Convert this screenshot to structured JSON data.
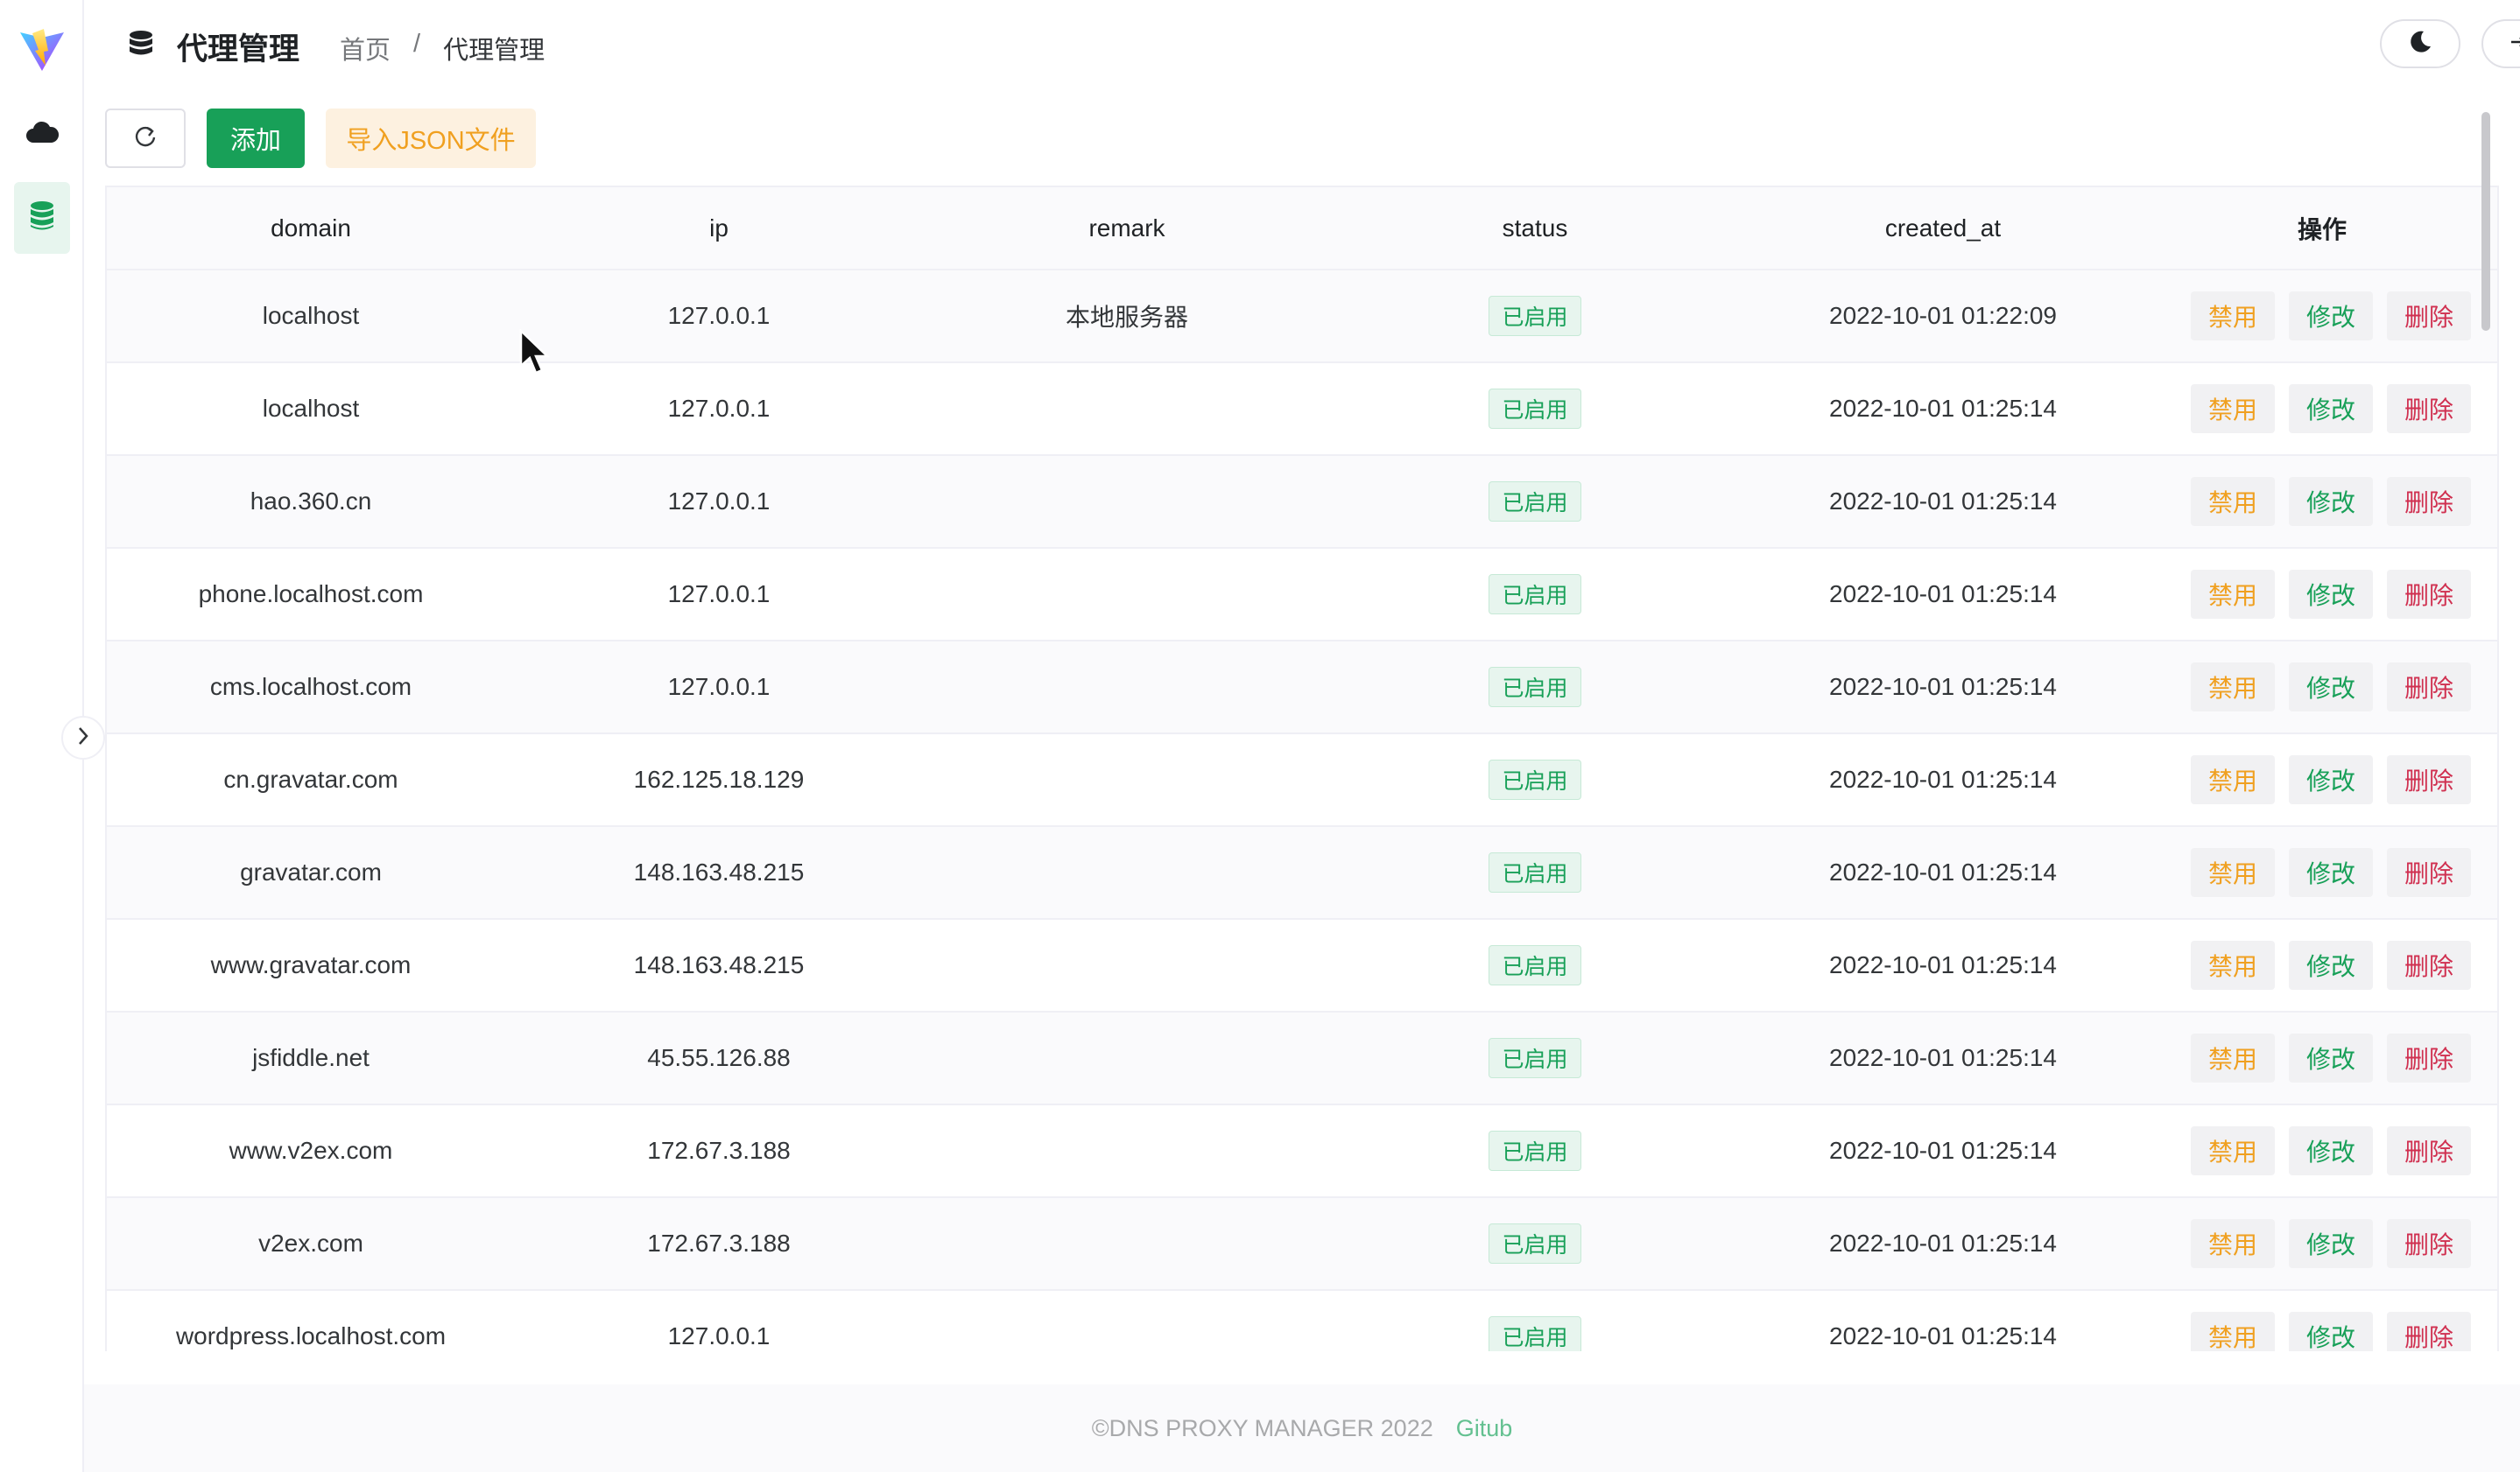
{
  "header": {
    "title": "代理管理",
    "breadcrumb": [
      "首页",
      "/",
      "代理管理"
    ]
  },
  "sidebar": {
    "items": [
      {
        "icon": "cloud-icon",
        "active": false
      },
      {
        "icon": "database-icon",
        "active": true
      }
    ]
  },
  "toolbar": {
    "add_label": "添加",
    "import_label": "导入JSON文件"
  },
  "table": {
    "columns": [
      "domain",
      "ip",
      "remark",
      "status",
      "created_at",
      "操作"
    ],
    "actions": {
      "disable": "禁用",
      "edit": "修改",
      "delete": "删除"
    },
    "rows": [
      {
        "domain": "localhost",
        "ip": "127.0.0.1",
        "remark": "本地服务器",
        "status": "已启用",
        "created_at": "2022-10-01 01:22:09"
      },
      {
        "domain": "localhost",
        "ip": "127.0.0.1",
        "remark": "",
        "status": "已启用",
        "created_at": "2022-10-01 01:25:14"
      },
      {
        "domain": "hao.360.cn",
        "ip": "127.0.0.1",
        "remark": "",
        "status": "已启用",
        "created_at": "2022-10-01 01:25:14"
      },
      {
        "domain": "phone.localhost.com",
        "ip": "127.0.0.1",
        "remark": "",
        "status": "已启用",
        "created_at": "2022-10-01 01:25:14"
      },
      {
        "domain": "cms.localhost.com",
        "ip": "127.0.0.1",
        "remark": "",
        "status": "已启用",
        "created_at": "2022-10-01 01:25:14"
      },
      {
        "domain": "cn.gravatar.com",
        "ip": "162.125.18.129",
        "remark": "",
        "status": "已启用",
        "created_at": "2022-10-01 01:25:14"
      },
      {
        "domain": "gravatar.com",
        "ip": "148.163.48.215",
        "remark": "",
        "status": "已启用",
        "created_at": "2022-10-01 01:25:14"
      },
      {
        "domain": "www.gravatar.com",
        "ip": "148.163.48.215",
        "remark": "",
        "status": "已启用",
        "created_at": "2022-10-01 01:25:14"
      },
      {
        "domain": "jsfiddle.net",
        "ip": "45.55.126.88",
        "remark": "",
        "status": "已启用",
        "created_at": "2022-10-01 01:25:14"
      },
      {
        "domain": "www.v2ex.com",
        "ip": "172.67.3.188",
        "remark": "",
        "status": "已启用",
        "created_at": "2022-10-01 01:25:14"
      },
      {
        "domain": "v2ex.com",
        "ip": "172.67.3.188",
        "remark": "",
        "status": "已启用",
        "created_at": "2022-10-01 01:25:14"
      },
      {
        "domain": "wordpress.localhost.com",
        "ip": "127.0.0.1",
        "remark": "",
        "status": "已启用",
        "created_at": "2022-10-01 01:25:14"
      }
    ]
  },
  "footer": {
    "copyright": "©DNS PROXY MANAGER 2022",
    "link": "Gitub"
  },
  "colors": {
    "primary": "#18a058",
    "warning": "#f0a020",
    "error": "#d03050"
  }
}
